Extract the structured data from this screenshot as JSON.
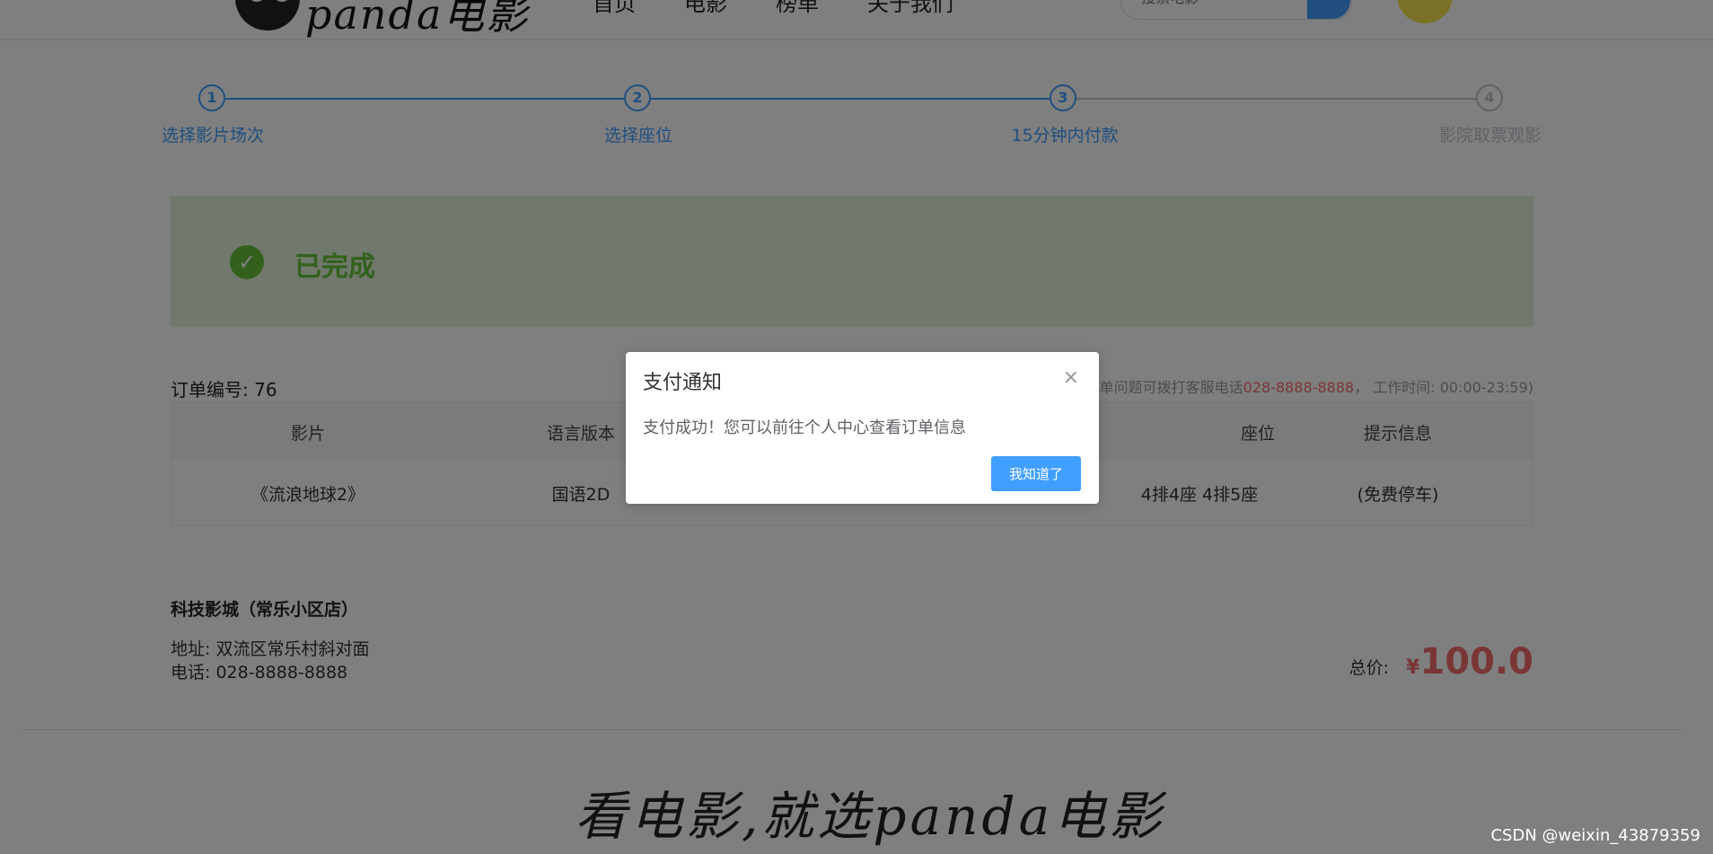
{
  "header": {
    "logo_text": "panda电影",
    "nav": [
      "首页",
      "电影",
      "榜单",
      "关于我们"
    ],
    "search_placeholder": "搜索电影"
  },
  "steps": [
    {
      "num": "1",
      "label": "选择影片场次",
      "status": "done"
    },
    {
      "num": "2",
      "label": "选择座位",
      "status": "done"
    },
    {
      "num": "3",
      "label": "15分钟内付款",
      "status": "done"
    },
    {
      "num": "4",
      "label": "影院取票观影",
      "status": "wait"
    }
  ],
  "banner": {
    "text": "已完成"
  },
  "order": {
    "number": "订单编号: 76",
    "tip_prefix": "（如有订单问题可拨打客服电话",
    "tip_phone": "028-8888-8888",
    "tip_suffix": "，  工作时间: 00:00-23:59)",
    "headers": [
      "影片",
      "语言版本",
      "",
      "座位",
      "提示信息"
    ],
    "row": [
      "《流浪地球2》",
      "国语2D",
      "",
      "4排4座 4排5座",
      "(免费停车)"
    ]
  },
  "cinema": {
    "name": "科技影城（常乐小区店）",
    "address": "地址: 双流区常乐村斜对面",
    "tel": "电话: 028-8888-8888"
  },
  "total": {
    "label": "总价:",
    "symbol": "¥",
    "value": "100.0"
  },
  "slogan": "看电影,就选panda电影",
  "watermark": "CSDN @weixin_43879359",
  "dialog": {
    "title": "支付通知",
    "close": "×",
    "message": "支付成功！您可以前往个人中心查看订单信息",
    "button": "我知道了"
  },
  "colors": {
    "primary": "#409eff",
    "success": "#67c23a",
    "danger": "#f56c6c",
    "wait": "#c0c4cc"
  }
}
